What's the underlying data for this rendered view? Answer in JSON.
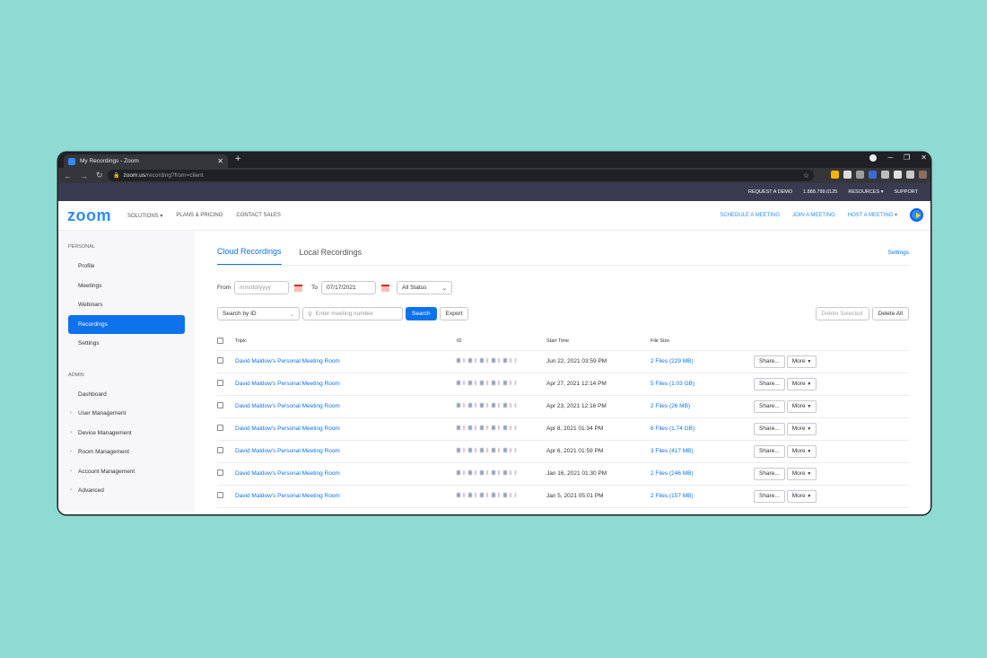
{
  "browser": {
    "tab_title": "My Recordings - Zoom",
    "url_host": "zoom.us",
    "url_path": "/recording?from=client"
  },
  "topstrip": {
    "items": [
      "REQUEST A DEMO",
      "1.888.799.0125",
      "RESOURCES ▾",
      "SUPPORT"
    ]
  },
  "header": {
    "logo": "zoom",
    "nav": [
      "SOLUTIONS ▾",
      "PLANS & PRICING",
      "CONTACT SALES"
    ],
    "right": [
      "SCHEDULE A MEETING",
      "JOIN A MEETING",
      "HOST A MEETING ▾"
    ]
  },
  "sidebar": {
    "personal_label": "PERSONAL",
    "personal": [
      "Profile",
      "Meetings",
      "Webinars",
      "Recordings",
      "Settings"
    ],
    "admin_label": "ADMIN",
    "admin": [
      "Dashboard",
      "User Management",
      "Device Management",
      "Room Management",
      "Account Management",
      "Advanced"
    ]
  },
  "tabs": {
    "cloud": "Cloud Recordings",
    "local": "Local Recordings",
    "settings": "Settings"
  },
  "filters": {
    "from_label": "From",
    "from_placeholder": "mm/dd/yyyy",
    "to_label": "To",
    "to_value": "07/17/2021",
    "status": "All Status"
  },
  "search": {
    "by": "Search by  ID",
    "placeholder": "Enter meeting number",
    "search_btn": "Search",
    "export_btn": "Export",
    "delete_selected": "Delete Selected",
    "delete_all": "Delete All"
  },
  "table": {
    "headers": {
      "topic": "Topic",
      "id": "ID",
      "start": "Start Time",
      "size": "File Size"
    },
    "share_label": "Share...",
    "more_label": "More",
    "rows": [
      {
        "topic": "David Maldow's Personal Meeting Room",
        "start": "Jun 22, 2021 03:59 PM",
        "size": "2 Files (229 MB)"
      },
      {
        "topic": "David Maldow's Personal Meeting Room",
        "start": "Apr 27, 2021 12:14 PM",
        "size": "5 Files (1.03 GB)"
      },
      {
        "topic": "David Maldow's Personal Meeting Room",
        "start": "Apr 23, 2021 12:16 PM",
        "size": "2 Files (26 MB)"
      },
      {
        "topic": "David Maldow's Personal Meeting Room",
        "start": "Apr 8, 2021 01:34 PM",
        "size": "6 Files (1.74 GB)"
      },
      {
        "topic": "David Maldow's Personal Meeting Room",
        "start": "Apr 6, 2021 01:59 PM",
        "size": "3 Files (417 MB)"
      },
      {
        "topic": "David Maldow's Personal Meeting Room",
        "start": "Jan 16, 2021 01:30 PM",
        "size": "2 Files (246 MB)"
      },
      {
        "topic": "David Maldow's Personal Meeting Room",
        "start": "Jan 5, 2021 05:01 PM",
        "size": "2 Files (157 MB)"
      }
    ]
  },
  "colors": {
    "accent": "#0e72ed",
    "background": "#8ddbd3"
  }
}
